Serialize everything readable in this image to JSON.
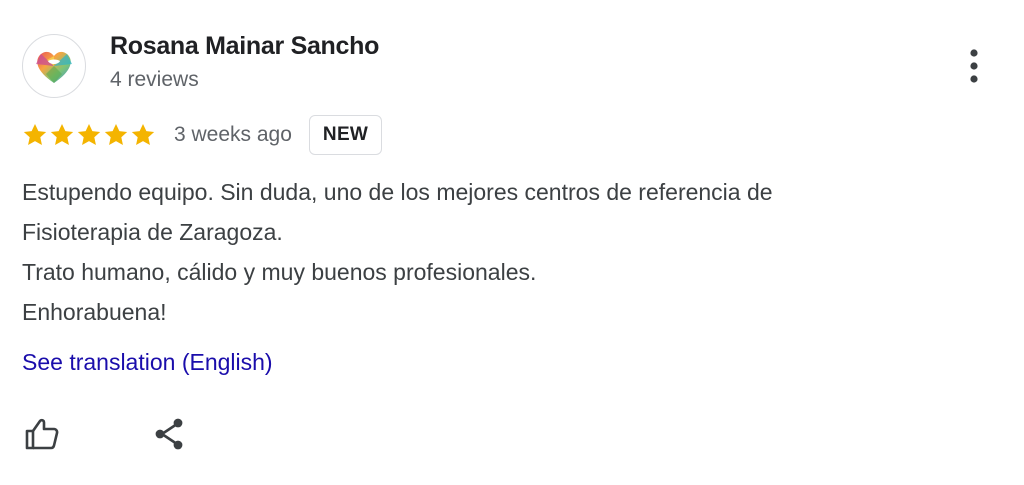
{
  "review": {
    "author": {
      "name": "Rosana Mainar Sancho",
      "meta": "4 reviews",
      "avatar_icon": "colorful-heart-avatar-icon"
    },
    "menu_icon": "more-vert-icon",
    "rating": {
      "stars": 5,
      "max_stars": 5,
      "star_color": "#f4b400"
    },
    "time_ago": "3 weeks ago",
    "badge": "NEW",
    "text_lines": [
      "Estupendo equipo. Sin duda, uno de los mejores centros de referencia de",
      "Fisioterapia de Zaragoza.",
      "Trato humano, cálido y muy buenos profesionales.",
      "Enhorabuena!"
    ],
    "translate_link": "See translation (English)",
    "actions": {
      "like_icon": "thumbs-up-icon",
      "share_icon": "share-icon"
    }
  },
  "colors": {
    "text_primary": "#202124",
    "text_secondary": "#5f6368",
    "link": "#1a0dab",
    "border": "#dadce0"
  }
}
